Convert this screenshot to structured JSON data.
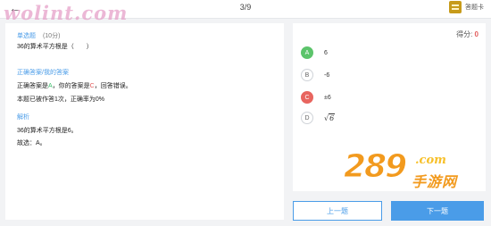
{
  "header": {
    "back_icon": "arrow-left-icon",
    "progress": "3/9",
    "answer_card_label": "答题卡",
    "answer_card_icon": "answer-card-icon"
  },
  "watermark": {
    "text": "wolint.com"
  },
  "question": {
    "type": "单选题",
    "points": "(10分)",
    "text": "36的算术平方根是（　　）"
  },
  "result": {
    "section_title": "正确答案/我的答案",
    "line_prefix": "正确答案是",
    "correct_letter": "A",
    "line_mid": "，你的答案是",
    "my_letter": "C",
    "line_suffix": "，回答错误。",
    "stats": "本题已被作答1次，正确率为0%"
  },
  "analysis": {
    "title": "解析",
    "line1": "36的算术平方根是6。",
    "line2": "故选：A。"
  },
  "score": {
    "label": "得分: ",
    "value": "0"
  },
  "options": [
    {
      "letter": "A",
      "text": "6",
      "state": "correct"
    },
    {
      "letter": "B",
      "text": "-6",
      "state": "normal"
    },
    {
      "letter": "C",
      "text": "±6",
      "state": "wrong"
    },
    {
      "letter": "D",
      "text": "6",
      "state": "normal",
      "sqrt": true
    }
  ],
  "logo": {
    "number": "289",
    "domain": ".com",
    "name": "手游网"
  },
  "buttons": {
    "prev": "上一题",
    "next": "下一题"
  },
  "colors": {
    "accent": "#4a9ce8",
    "correct": "#5cc46b",
    "wrong": "#e8655f"
  }
}
